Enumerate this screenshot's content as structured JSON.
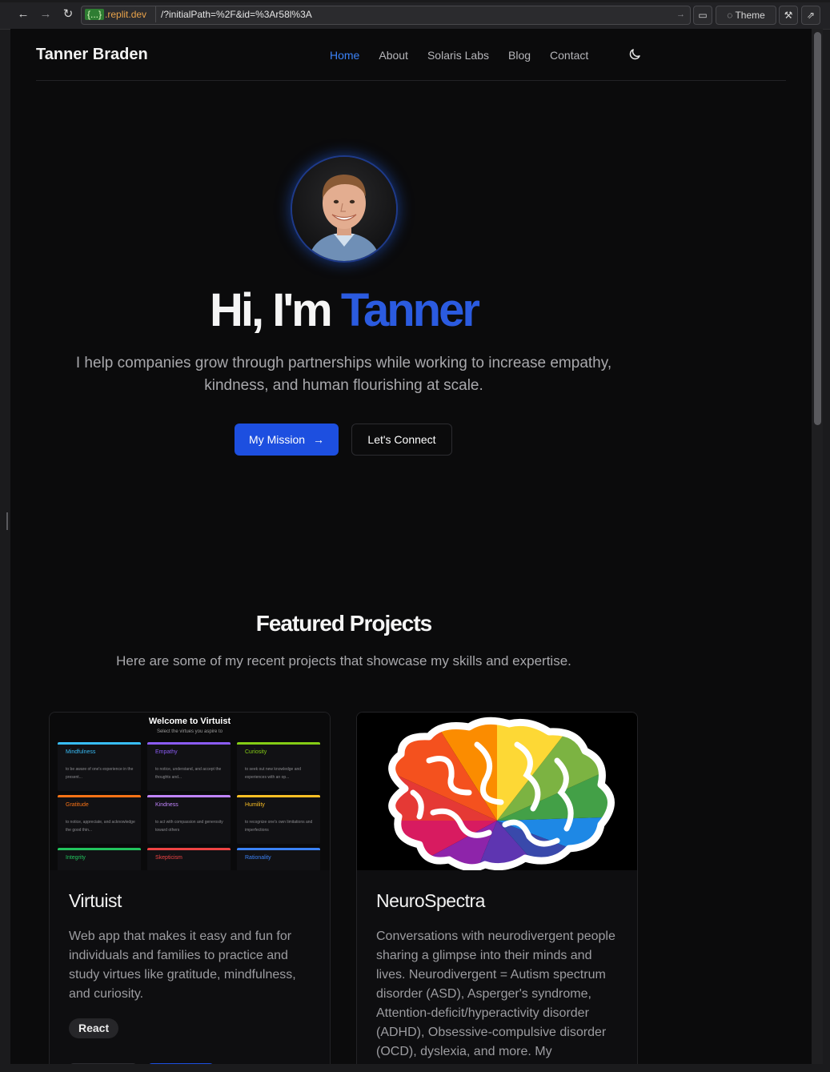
{
  "browser": {
    "url_host_badge": "{...}",
    "url_host": ".replit.dev",
    "url_path": "/?initialPath=%2F&id=%3Ar58l%3A",
    "theme_label": "Theme"
  },
  "site": {
    "brand": "Tanner Braden",
    "nav": [
      {
        "label": "Home"
      },
      {
        "label": "About"
      },
      {
        "label": "Solaris Labs"
      },
      {
        "label": "Blog"
      },
      {
        "label": "Contact"
      }
    ]
  },
  "hero": {
    "title_prefix": "Hi, I'm ",
    "title_name": "Tanner",
    "subtitle": "I help companies grow through partnerships while working to increase empathy, kindness, and human flourishing at scale.",
    "primary_button": "My Mission",
    "secondary_button": "Let's Connect"
  },
  "projects": {
    "title": "Featured Projects",
    "subtitle": "Here are some of my recent projects that showcase my skills and expertise.",
    "items": [
      {
        "name": "Virtuist",
        "description": "Web app that makes it easy and fun for individuals and families to practice and study virtues like gratitude, mindfulness, and curiosity.",
        "tag": "React",
        "thumb": {
          "title": "Welcome to Virtuist",
          "subtitle": "Select the virtues you aspire to",
          "tiles": [
            {
              "name": "Mindfulness",
              "color": "#38bdf8",
              "desc": "to be aware of one's experience in the present..."
            },
            {
              "name": "Empathy",
              "color": "#8b5cf6",
              "desc": "to notice, understand, and accept the thoughts and..."
            },
            {
              "name": "Curiosity",
              "color": "#84cc16",
              "desc": "to seek out new knowledge and experiences with an op..."
            },
            {
              "name": "Gratitude",
              "color": "#f97316",
              "desc": "to notice, appreciate, and acknowledge the good thin..."
            },
            {
              "name": "Kindness",
              "color": "#c084fc",
              "desc": "to act with compassion and generosity toward others"
            },
            {
              "name": "Humility",
              "color": "#fbbf24",
              "desc": "to recognize one's own limitations and imperfections"
            },
            {
              "name": "Integrity",
              "color": "#22c55e",
              "desc": ""
            },
            {
              "name": "Skepticism",
              "color": "#ef4444",
              "desc": ""
            },
            {
              "name": "Rationality",
              "color": "#3b82f6",
              "desc": ""
            }
          ]
        }
      },
      {
        "name": "NeuroSpectra",
        "description": "Conversations with neurodivergent people sharing a glimpse into their minds and lives. Neurodivergent = Autism spectrum disorder (ASD), Asperger's syndrome, Attention-deficit/hyperactivity disorder (ADHD), Obsessive-compulsive disorder (OCD), dyslexia, and more. My"
      }
    ]
  },
  "icons": {
    "back": "arrow-left-icon",
    "forward": "arrow-right-icon",
    "reload": "reload-icon",
    "theme_toggle": "moon-icon"
  }
}
